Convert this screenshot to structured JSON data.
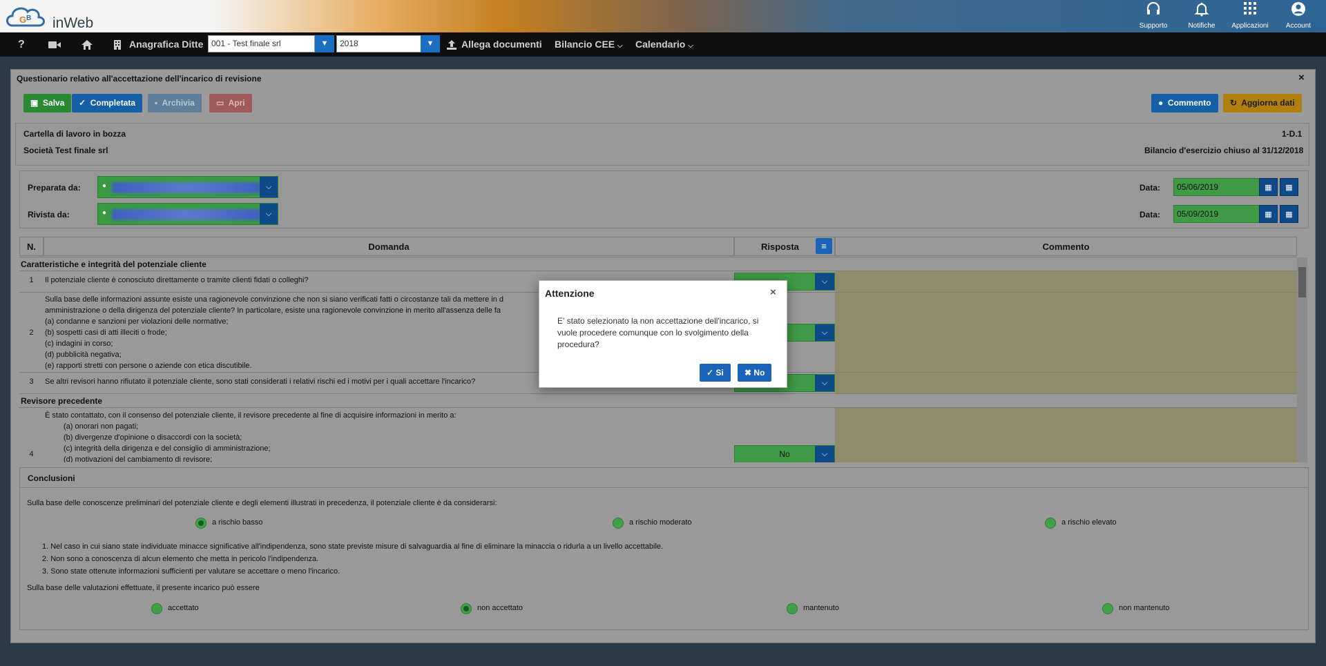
{
  "app": {
    "logo_text": "inWeb"
  },
  "topbar": {
    "items": [
      {
        "label": "Supporto",
        "icon": "headset-icon"
      },
      {
        "label": "Notifiche",
        "icon": "bell-icon"
      },
      {
        "label": "Applicazioni",
        "icon": "apps-grid-icon"
      },
      {
        "label": "Account",
        "icon": "account-icon"
      }
    ]
  },
  "navbar": {
    "help": "?",
    "anagrafica": "Anagrafica Ditte",
    "ditta_value": "001 - Test finale srl",
    "year_value": "2018",
    "allega": "Allega documenti",
    "bilancio": "Bilancio CEE",
    "calendario": "Calendario"
  },
  "panel": {
    "title": "Questionario relativo all'accettazione dell'incarico di revisione",
    "close": "×",
    "buttons": {
      "salva": "Salva",
      "completata": "Completata",
      "archivia": "Archivia",
      "apri": "Apri",
      "commento": "Commento",
      "aggiorna": "Aggiorna dati"
    },
    "status": "Cartella di lavoro in bozza",
    "code": "1-D.1",
    "company": "Società Test finale srl",
    "bilancio": "Bilancio d'esercizio chiuso al 31/12/2018",
    "preparata_label": "Preparata da:",
    "rivista_label": "Rivista da:",
    "data_label": "Data:",
    "preparata_date": "05/06/2019",
    "rivista_date": "05/09/2019"
  },
  "grid": {
    "headers": {
      "n": "N.",
      "domanda": "Domanda",
      "risposta": "Risposta",
      "commento": "Commento"
    },
    "section1": "Caratteristiche e integrità del potenziale cliente",
    "q1": "Il potenziale cliente è conosciuto direttamente o tramite clienti fidati o colleghi?",
    "q2": [
      "Sulla base delle informazioni assunte esiste una ragionevole convinzione che non si siano verificati fatti o circostanze tali da mettere in d",
      "amministrazione o della dirigenza del potenziale cliente? In particolare, esiste una ragionevole convinzione in merito all'assenza delle fa",
      "(a)    condanne e sanzioni per violazioni delle normative;",
      "(b)    sospetti casi di atti illeciti o frode;",
      "(c)    indagini in corso;",
      "(d)    pubblicità negativa;",
      "(e)    rapporti stretti con persone o aziende con etica discutibile."
    ],
    "q3": "Se altri revisori hanno rifiutato il potenziale cliente, sono stati considerati i relativi rischi ed i motivi per i quali accettare l'incarico?",
    "section2": "Revisore precedente",
    "q4": [
      "È stato contattato, con il consenso del potenziale cliente, il revisore precedente al fine di acquisire informazioni in merito a:",
      "(a) onorari non pagati;",
      "(b) divergenze d'opinione o disaccordi con la società;",
      "(c) integrità della dirigenza e del consiglio di amministrazione;",
      "(d) motivazioni del cambiamento di revisore;"
    ],
    "numbers": [
      "1",
      "2",
      "3",
      "4"
    ],
    "answer_q4": "No"
  },
  "conclusioni": {
    "title": "Conclusioni",
    "intro": "Sulla base delle conoscenze preliminari del potenziale cliente e degli elementi illustrati in precedenza, il potenziale cliente è da considerarsi:",
    "risk": [
      "a rischio basso",
      "a rischio moderato",
      "a rischio elevato"
    ],
    "notes": [
      "1. Nel caso in cui siano state individuate minacce significative all'indipendenza, sono state previste misure di salvaguardia al fine di eliminare la minaccia o ridurla a un livello accettabile.",
      "2. Non sono a conoscenza di alcun elemento che metta in pericolo l'indipendenza.",
      "3. Sono state ottenute informazioni sufficienti per valutare se accettare o meno l'incarico."
    ],
    "valutazione": "Sulla base delle valutazioni effettuate, il presente incarico può essere",
    "esito": [
      "accettato",
      "non accettato",
      "mantenuto",
      "non mantenuto"
    ]
  },
  "modal": {
    "title": "Attenzione",
    "close": "×",
    "body": "E' stato selezionato la non accettazione dell'incarico, si vuole procedere comunque con lo svolgimento della procedura?",
    "yes": "Si",
    "no": "No"
  }
}
